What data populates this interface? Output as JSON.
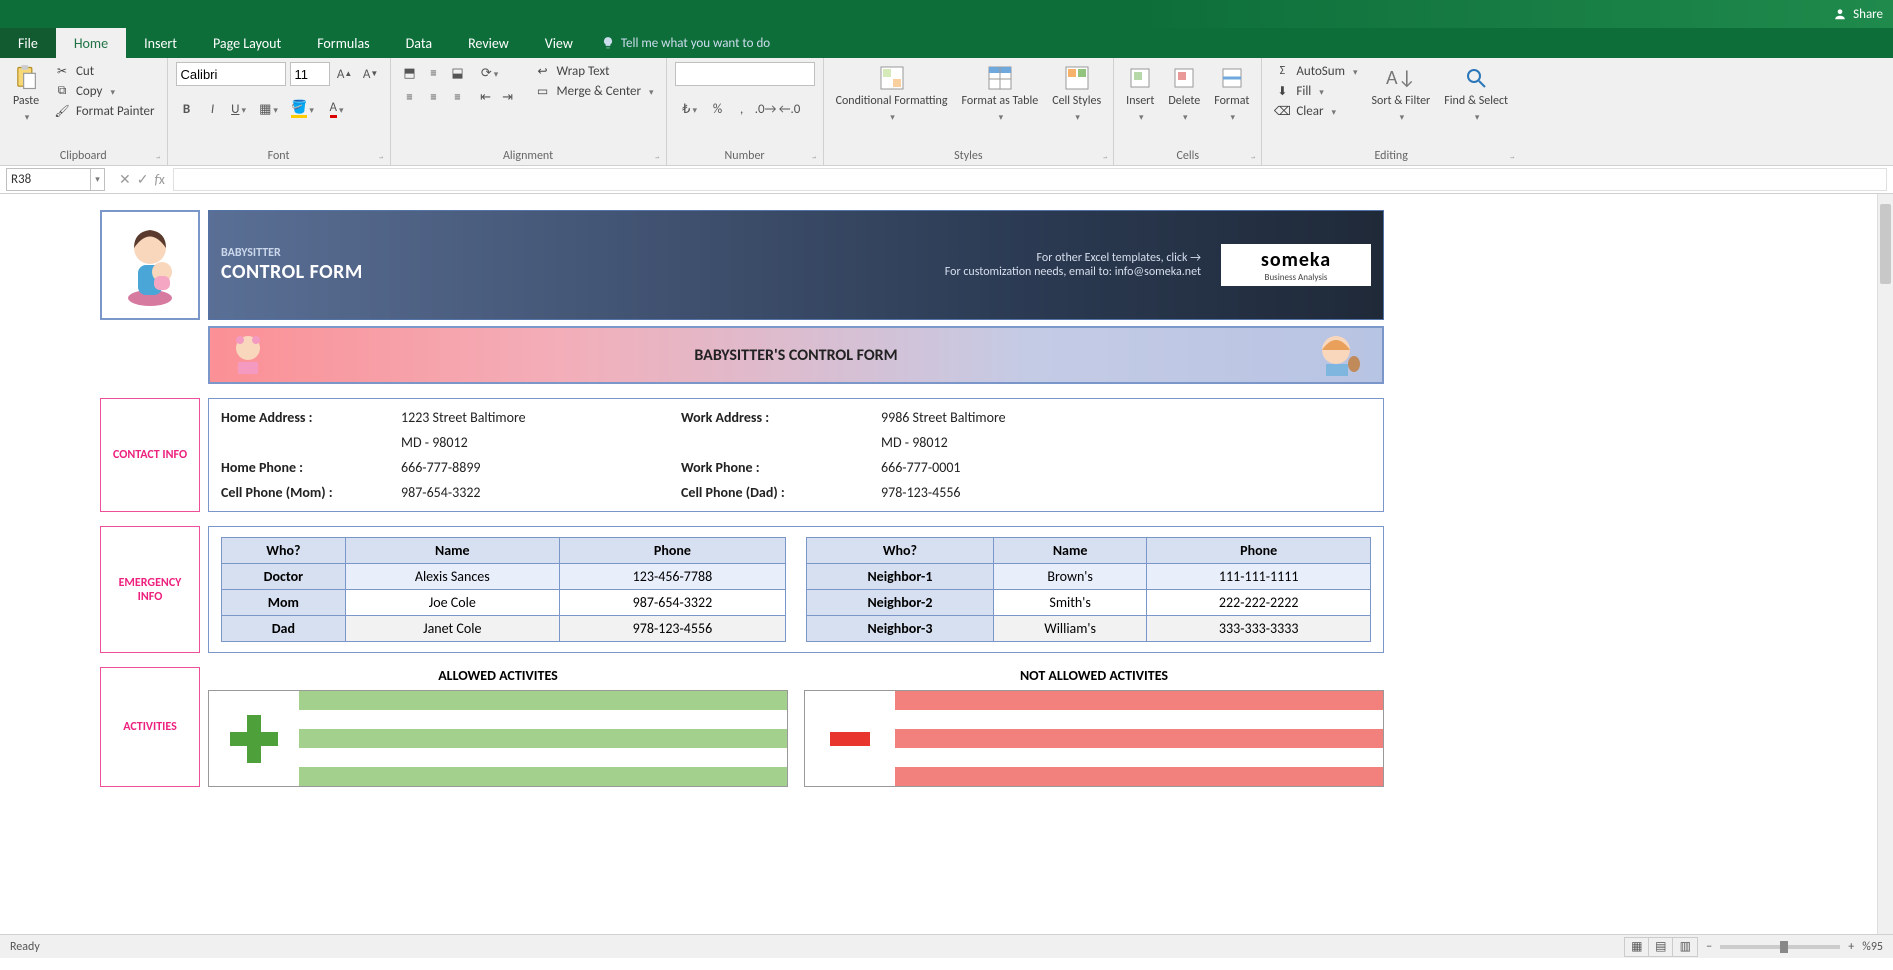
{
  "titlebar": {
    "share": "Share"
  },
  "tabs": {
    "file": "File",
    "home": "Home",
    "insert": "Insert",
    "pagelayout": "Page Layout",
    "formulas": "Formulas",
    "data": "Data",
    "review": "Review",
    "view": "View",
    "tell": "Tell me what you want to do"
  },
  "ribbon": {
    "clipboard": {
      "paste": "Paste",
      "cut": "Cut",
      "copy": "Copy",
      "format_painter": "Format Painter",
      "label": "Clipboard"
    },
    "font": {
      "name": "Calibri",
      "size": "11",
      "label": "Font"
    },
    "alignment": {
      "wrap": "Wrap Text",
      "merge": "Merge & Center",
      "label": "Alignment"
    },
    "number": {
      "label": "Number"
    },
    "styles": {
      "cond": "Conditional Formatting",
      "fat": "Format as Table",
      "cell": "Cell Styles",
      "label": "Styles"
    },
    "cells": {
      "insert": "Insert",
      "delete": "Delete",
      "format": "Format",
      "label": "Cells"
    },
    "editing": {
      "autosum": "AutoSum",
      "fill": "Fill",
      "clear": "Clear",
      "sort": "Sort & Filter",
      "find": "Find & Select",
      "label": "Editing"
    }
  },
  "namebox": "R38",
  "doc": {
    "brand_small": "BABYSITTER",
    "brand_big": "CONTROL FORM",
    "header_line1": "For other Excel templates, click →",
    "header_line2": "For customization needs, email to: info@someka.net",
    "someka": "someka",
    "someka_sub": "Business Analysis",
    "pink_title": "BABYSITTER'S CONTROL FORM",
    "sections": {
      "contact": {
        "label": "CONTACT INFO",
        "home_addr_l": "Home Address :",
        "home_addr1": "1223 Street Baltimore",
        "home_addr2": "MD - 98012",
        "work_addr_l": "Work Address :",
        "work_addr1": "9986 Street Baltimore",
        "work_addr2": "MD - 98012",
        "home_phone_l": "Home Phone :",
        "home_phone": "666-777-8899",
        "work_phone_l": "Work Phone :",
        "work_phone": "666-777-0001",
        "cell_mom_l": "Cell Phone (Mom) :",
        "cell_mom": "987-654-3322",
        "cell_dad_l": "Cell Phone (Dad) :",
        "cell_dad": "978-123-4556"
      },
      "emergency": {
        "label": "EMERGENCY INFO",
        "headers": {
          "who": "Who?",
          "name": "Name",
          "phone": "Phone"
        },
        "left": [
          {
            "who": "Doctor",
            "name": "Alexis Sances",
            "phone": "123-456-7788"
          },
          {
            "who": "Mom",
            "name": "Joe Cole",
            "phone": "987-654-3322"
          },
          {
            "who": "Dad",
            "name": "Janet Cole",
            "phone": "978-123-4556"
          }
        ],
        "right": [
          {
            "who": "Neighbor-1",
            "name": "Brown's",
            "phone": "111-111-1111"
          },
          {
            "who": "Neighbor-2",
            "name": "Smith's",
            "phone": "222-222-2222"
          },
          {
            "who": "Neighbor-3",
            "name": "William's",
            "phone": "333-333-3333"
          }
        ]
      },
      "activities": {
        "label": "ACTIVITIES",
        "allowed": "ALLOWED ACTIVITES",
        "notallowed": "NOT ALLOWED ACTIVITES"
      }
    }
  },
  "status": {
    "ready": "Ready",
    "zoom": "%95"
  }
}
